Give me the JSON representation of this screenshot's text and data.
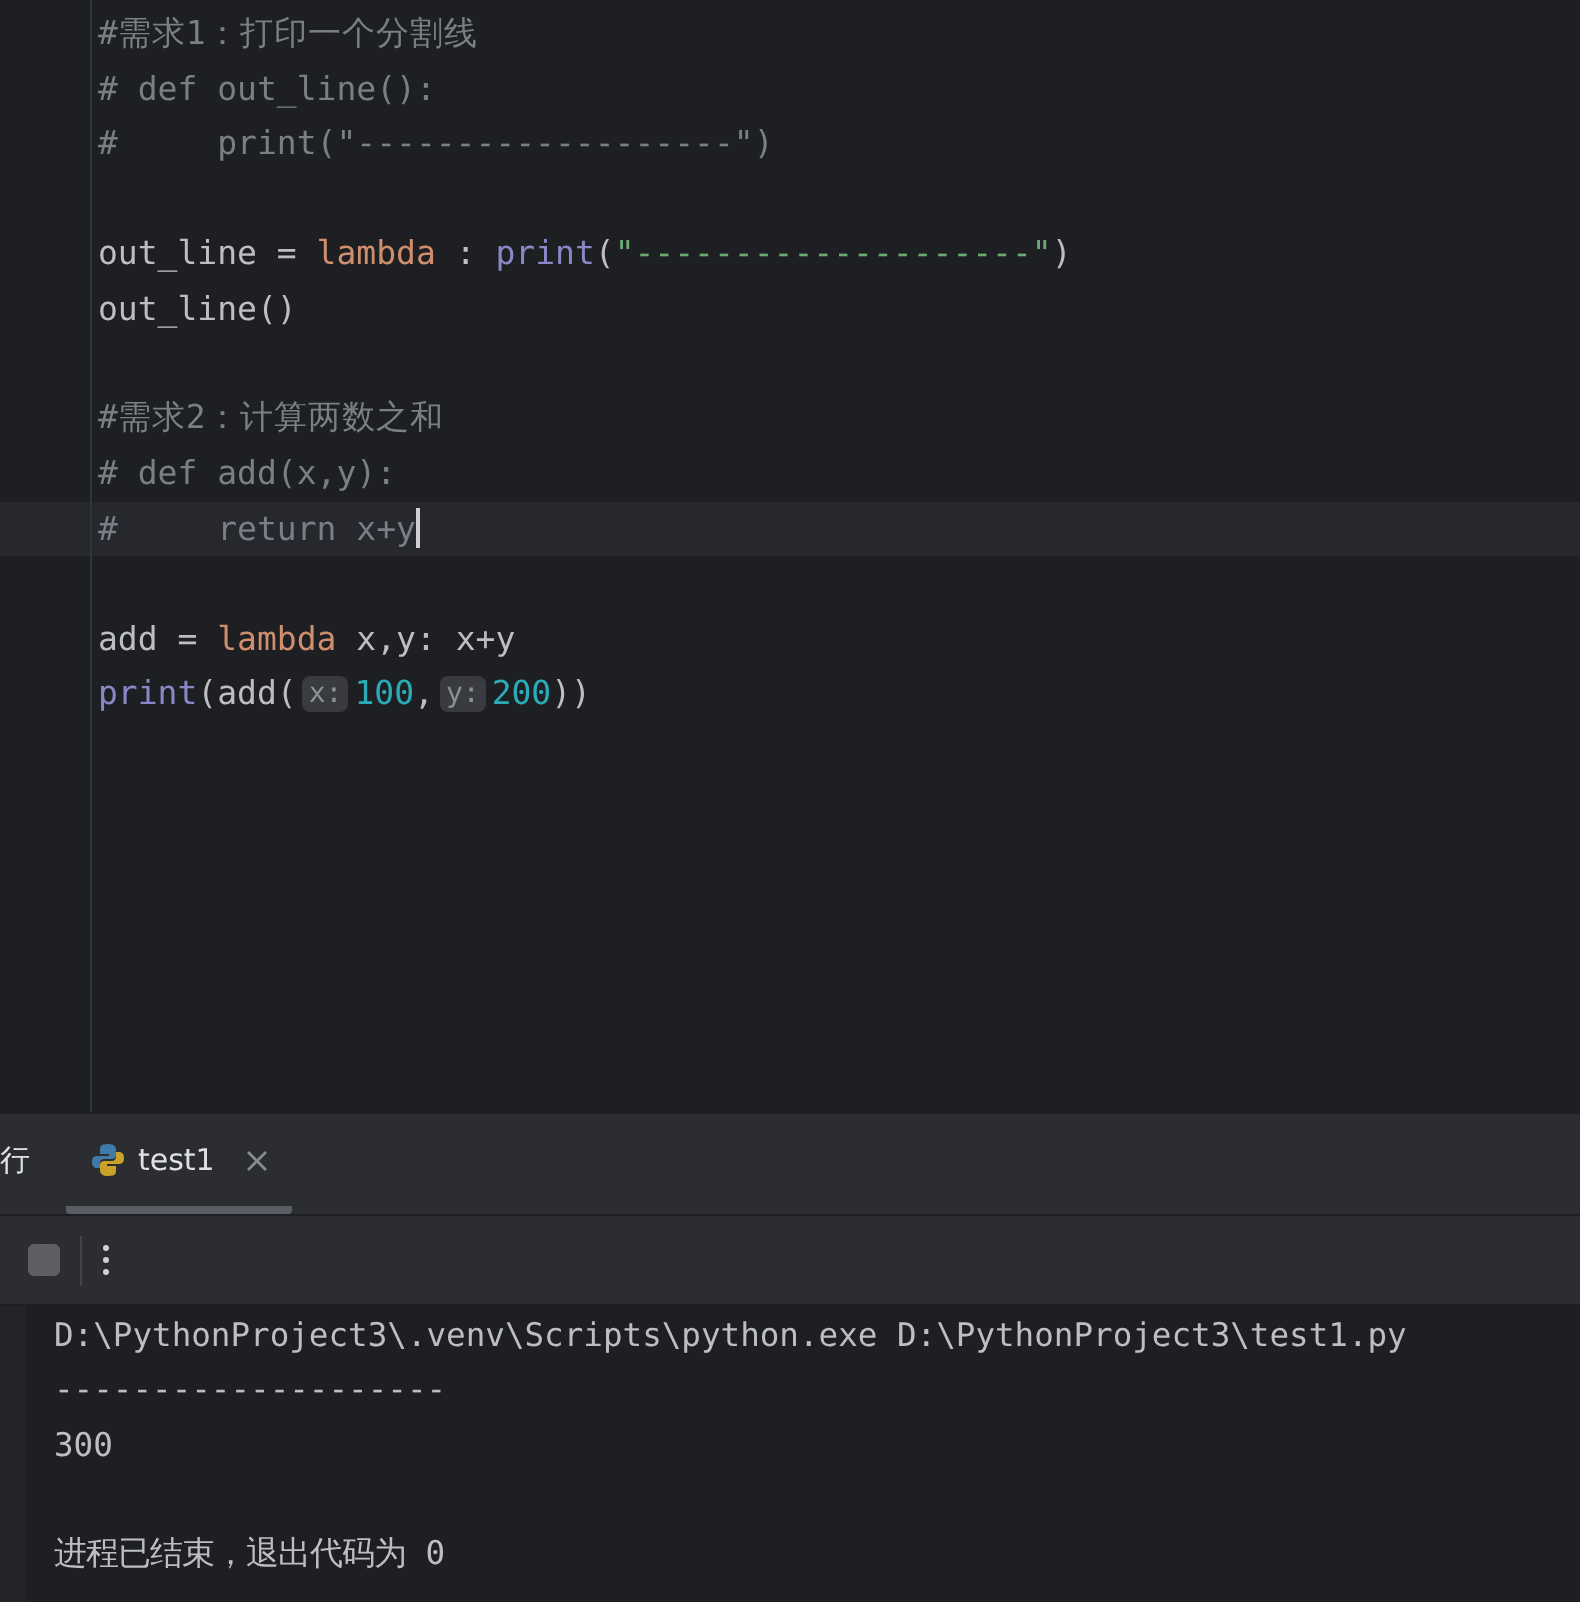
{
  "editor": {
    "lines": [
      {
        "kind": "code",
        "current": false,
        "tokens": [
          {
            "kind": "comment",
            "text": "#需求1：打印一个分割线"
          }
        ]
      },
      {
        "kind": "code",
        "current": false,
        "tokens": [
          {
            "kind": "comment",
            "text": "# def out_line():"
          }
        ]
      },
      {
        "kind": "code",
        "current": false,
        "tokens": [
          {
            "kind": "comment",
            "text": "#     print(\"-------------------\")"
          }
        ]
      },
      {
        "kind": "blank"
      },
      {
        "kind": "code",
        "current": false,
        "tokens": [
          {
            "kind": "plain",
            "text": "out_line = "
          },
          {
            "kind": "keyword",
            "text": "lambda"
          },
          {
            "kind": "plain",
            "text": " : "
          },
          {
            "kind": "builtin",
            "text": "print"
          },
          {
            "kind": "plain",
            "text": "("
          },
          {
            "kind": "string",
            "text": "\"--------------------\""
          },
          {
            "kind": "plain",
            "text": ")"
          }
        ]
      },
      {
        "kind": "code",
        "current": false,
        "tokens": [
          {
            "kind": "plain",
            "text": "out_line()"
          }
        ]
      },
      {
        "kind": "blank"
      },
      {
        "kind": "code",
        "current": false,
        "tokens": [
          {
            "kind": "comment",
            "text": "#需求2：计算两数之和"
          }
        ]
      },
      {
        "kind": "code",
        "current": false,
        "tokens": [
          {
            "kind": "comment",
            "text": "# def add(x,y):"
          }
        ]
      },
      {
        "kind": "code",
        "current": true,
        "tokens": [
          {
            "kind": "comment",
            "text": "#     return x+y"
          }
        ]
      },
      {
        "kind": "blank"
      },
      {
        "kind": "code",
        "current": false,
        "tokens": [
          {
            "kind": "plain",
            "text": "add = "
          },
          {
            "kind": "keyword",
            "text": "lambda"
          },
          {
            "kind": "plain",
            "text": " x,y: x+y"
          }
        ]
      },
      {
        "kind": "code",
        "current": false,
        "tokens": [
          {
            "kind": "builtin",
            "text": "print"
          },
          {
            "kind": "plain",
            "text": "(add("
          },
          {
            "kind": "hint",
            "text": "x:"
          },
          {
            "kind": "number",
            "text": "100"
          },
          {
            "kind": "plain",
            "text": ","
          },
          {
            "kind": "hint",
            "text": "y:"
          },
          {
            "kind": "number",
            "text": "200"
          },
          {
            "kind": "plain",
            "text": "))"
          }
        ]
      }
    ]
  },
  "run_panel": {
    "tabs": [
      {
        "label": "行",
        "selected": false,
        "closable": false
      },
      {
        "label": "test1",
        "selected": true,
        "closable": true
      }
    ],
    "toolbar": {
      "stop_disabled": true
    },
    "console": [
      {
        "kind": "output",
        "text": "D:\\PythonProject3\\.venv\\Scripts\\python.exe D:\\PythonProject3\\test1.py"
      },
      {
        "kind": "output",
        "text": "--------------------"
      },
      {
        "kind": "output",
        "text": "300"
      },
      {
        "kind": "blank"
      },
      {
        "kind": "output",
        "text": "进程已结束，退出代码为 0"
      }
    ]
  }
}
